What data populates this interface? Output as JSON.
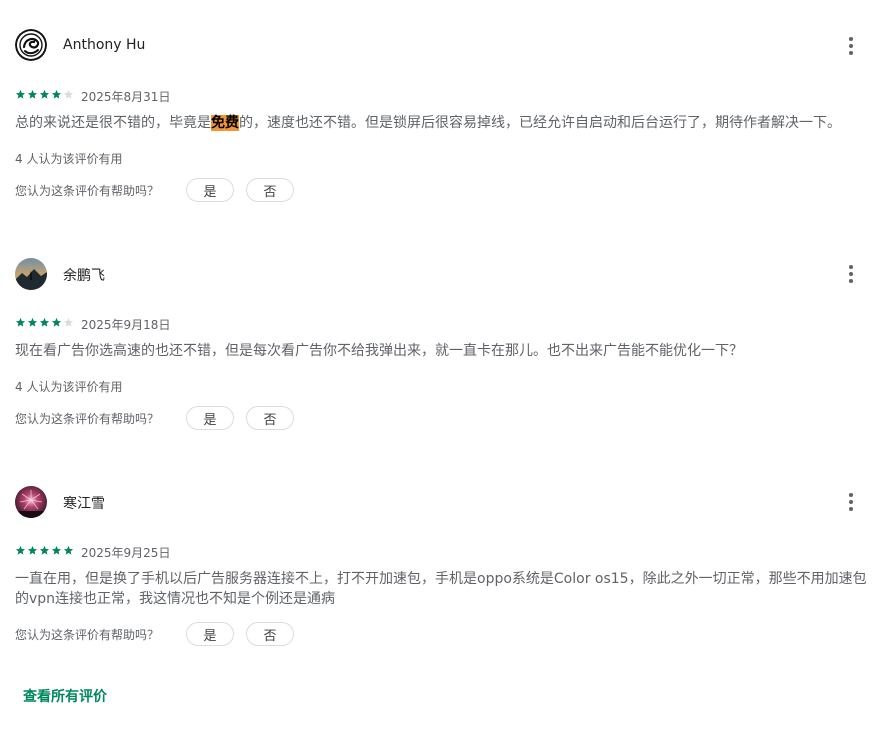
{
  "colors": {
    "star": "#01875f",
    "star_empty": "#dadce0",
    "accent": "#01875f",
    "highlight": "#f19537"
  },
  "reviews": [
    {
      "author": "Anthony Hu",
      "avatar": "dragon-emblem-avatar",
      "rating": 4,
      "date": "2025年8月31日",
      "text_before": "总的来说还是很不错的，毕竟是",
      "text_highlight": "免费",
      "text_after": "的，速度也还不错。但是锁屏后很容易掉线，已经允许自启动和后台运行了，期待作者解决一下。",
      "helpful_count": "4 人认为该评价有用",
      "helpful_question": "您认为这条评价有帮助吗？",
      "yes_label": "是",
      "no_label": "否"
    },
    {
      "author": "余鹏飞",
      "avatar": "mountain-photo-avatar",
      "rating": 4,
      "date": "2025年9月18日",
      "text": "现在看广告你选高速的也还不错，但是每次看广告你不给我弹出来，就一直卡在那儿。也不出来广告能不能优化一下？",
      "helpful_count": "4 人认为该评价有用",
      "helpful_question": "您认为这条评价有帮助吗？",
      "yes_label": "是",
      "no_label": "否"
    },
    {
      "author": "寒江雪",
      "avatar": "fireworks-photo-avatar",
      "rating": 5,
      "date": "2025年9月25日",
      "text": "一直在用，但是换了手机以后广告服务器连接不上，打不开加速包，手机是oppo系统是Color os15，除此之外一切正常，那些不用加速包的vpn连接也正常，我这情况也不知是个例还是通病",
      "helpful_question": "您认为这条评价有帮助吗？",
      "yes_label": "是",
      "no_label": "否"
    }
  ],
  "see_all_label": "查看所有评价"
}
